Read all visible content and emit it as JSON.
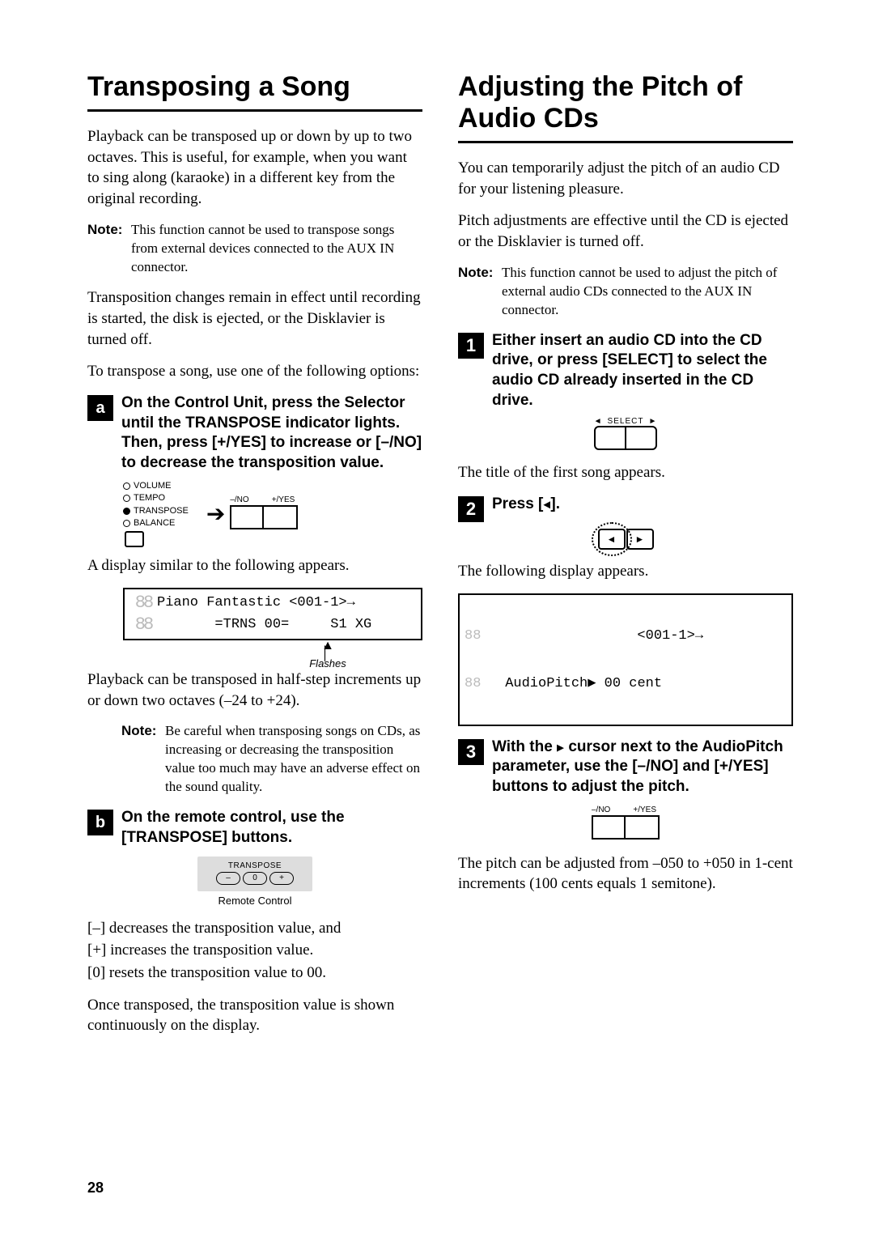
{
  "left": {
    "heading": "Transposing a Song",
    "intro": "Playback can be transposed up or down by up to two octaves. This is useful, for example, when you want to sing along (karaoke) in a different key from the original recording.",
    "note1_label": "Note:",
    "note1_text": "This function cannot be used to transpose songs from external devices connected to the AUX IN connector.",
    "para2": "Transposition changes remain in effect until recording is started, the disk is ejected, or the Disklavier is turned off.",
    "para3": "To transpose a song, use one of the following options:",
    "step_a": {
      "badge": "a",
      "head": "On the Control Unit, press the Selector until the TRANSPOSE indicator lights. Then, press [+/YES] to increase or [–/NO] to decrease the transposition value.",
      "led": {
        "volume": "VOLUME",
        "tempo": "TEMPO",
        "transpose": "TRANSPOSE",
        "balance": "BALANCE"
      },
      "pair": {
        "no": "–/NO",
        "yes": "+/YES"
      },
      "after_para": "A display similar to the following appears.",
      "lcd": {
        "line1": "Piano Fantastic <001-1>→",
        "line2": "=TRNS 00=     S1 XG"
      },
      "flashes": "Flashes",
      "after_lcd": "Playback can be transposed in half-step increments up or down two octaves (–24 to +24).",
      "note2_label": "Note:",
      "note2_text": "Be careful when transposing songs on CDs, as increasing or decreasing the transposition value too much may have an adverse effect on the sound quality."
    },
    "step_b": {
      "badge": "b",
      "head": "On the remote control, use the [TRANSPOSE] buttons.",
      "remote_label": "TRANSPOSE",
      "remote_minus": "–",
      "remote_zero": "0",
      "remote_plus": "+",
      "remote_caption": "Remote Control",
      "desc_minus": "[–] decreases the transposition value, and",
      "desc_plus": "[+] increases the transposition value.",
      "desc_zero": "[0] resets the transposition value to 00.",
      "final": "Once transposed, the transposition value is shown continuously on the display."
    }
  },
  "right": {
    "heading": "Adjusting the Pitch of Audio CDs",
    "intro": "You can temporarily adjust the pitch of an audio CD for your listening pleasure.",
    "para2": "Pitch adjustments are effective until the CD is ejected or the Disklavier is turned off.",
    "note1_label": "Note:",
    "note1_text": "This function cannot be used to adjust the pitch of external audio CDs connected to the AUX IN connector.",
    "step1": {
      "badge": "1",
      "head": "Either insert an audio CD into the CD drive, or press [SELECT] to select the audio CD already inserted in the CD drive.",
      "select_label": "SELECT",
      "after": "The title of the first song appears."
    },
    "step2": {
      "badge": "2",
      "head_pre": "Press [",
      "head_icon": "◄",
      "head_post": "].",
      "after": "The following display appears.",
      "lcd": {
        "line1": "                 <001-1>→",
        "line2": " AudioPitch▶ 00 cent"
      }
    },
    "step3": {
      "badge": "3",
      "head_pre": "With the ",
      "head_icon": "▶",
      "head_mid": " cursor next to the AudioPitch parameter, use the [–/NO] and [+/YES] buttons to adjust the pitch.",
      "pair": {
        "no": "–/NO",
        "yes": "+/YES"
      },
      "after": "The pitch can be adjusted from –050 to +050 in 1-cent increments (100 cents equals 1 semitone)."
    }
  },
  "page_number": "28",
  "chart_data": null
}
